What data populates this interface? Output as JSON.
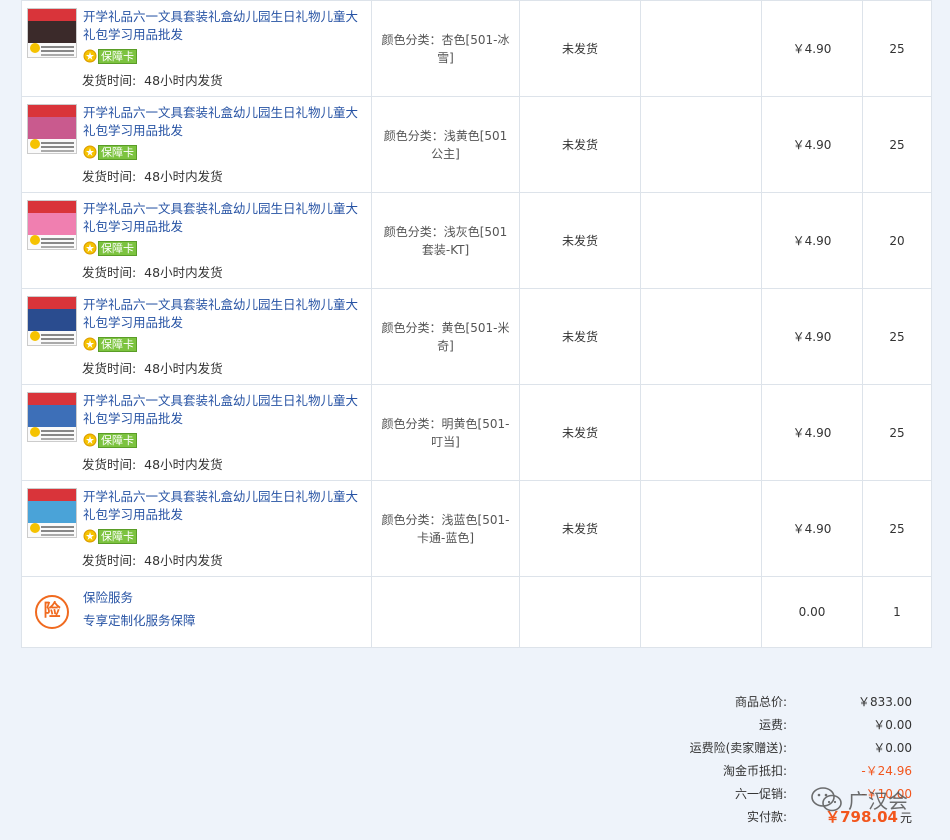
{
  "items": [
    {
      "title": "开学礼品六一文具套装礼盒幼儿园生日礼物儿童大礼包学习用品批发",
      "badge": "保障卡",
      "ship_label": "发货时间:",
      "ship_value": "48小时内发货",
      "sku": "颜色分类：杏色[501-冰雪]",
      "status": "未发货",
      "price": "￥4.90",
      "qty": "25",
      "thumb_colors": [
        "#d9343a",
        "#3b2a2a"
      ]
    },
    {
      "title": "开学礼品六一文具套装礼盒幼儿园生日礼物儿童大礼包学习用品批发",
      "badge": "保障卡",
      "ship_label": "发货时间:",
      "ship_value": "48小时内发货",
      "sku": "颜色分类：浅黄色[501公主]",
      "status": "未发货",
      "price": "￥4.90",
      "qty": "25",
      "thumb_colors": [
        "#d9343a",
        "#c95a8e"
      ]
    },
    {
      "title": "开学礼品六一文具套装礼盒幼儿园生日礼物儿童大礼包学习用品批发",
      "badge": "保障卡",
      "ship_label": "发货时间:",
      "ship_value": "48小时内发货",
      "sku": "颜色分类：浅灰色[501套装-KT]",
      "status": "未发货",
      "price": "￥4.90",
      "qty": "20",
      "thumb_colors": [
        "#d9343a",
        "#f07fb0"
      ]
    },
    {
      "title": "开学礼品六一文具套装礼盒幼儿园生日礼物儿童大礼包学习用品批发",
      "badge": "保障卡",
      "ship_label": "发货时间:",
      "ship_value": "48小时内发货",
      "sku": "颜色分类：黄色[501-米奇]",
      "status": "未发货",
      "price": "￥4.90",
      "qty": "25",
      "thumb_colors": [
        "#d9343a",
        "#2a4c8f"
      ]
    },
    {
      "title": "开学礼品六一文具套装礼盒幼儿园生日礼物儿童大礼包学习用品批发",
      "badge": "保障卡",
      "ship_label": "发货时间:",
      "ship_value": "48小时内发货",
      "sku": "颜色分类：明黄色[501-叮当]",
      "status": "未发货",
      "price": "￥4.90",
      "qty": "25",
      "thumb_colors": [
        "#d9343a",
        "#3d6fb8"
      ]
    },
    {
      "title": "开学礼品六一文具套装礼盒幼儿园生日礼物儿童大礼包学习用品批发",
      "badge": "保障卡",
      "ship_label": "发货时间:",
      "ship_value": "48小时内发货",
      "sku": "颜色分类：浅蓝色[501-卡通-蓝色]",
      "status": "未发货",
      "price": "￥4.90",
      "qty": "25",
      "thumb_colors": [
        "#d9343a",
        "#4aa3d8"
      ]
    }
  ],
  "service": {
    "icon_char": "险",
    "title": "保险服务",
    "subtitle": "专享定制化服务保障",
    "price": "0.00",
    "qty": "1"
  },
  "summary": {
    "rows": [
      {
        "label": "商品总价:",
        "value": "￥833.00"
      },
      {
        "label": "运费:",
        "value": "￥0.00"
      },
      {
        "label": "运费险(卖家赠送):",
        "value": "￥0.00"
      },
      {
        "label": "淘金币抵扣:",
        "value": "-￥24.96"
      },
      {
        "label": "六一促销:",
        "value": "-￥10.00"
      }
    ],
    "final_label": "实付款:",
    "final_value": "￥798.04",
    "final_unit": "元"
  },
  "watermark": {
    "text": "广汉会"
  },
  "colors": {
    "link": "#2753a4",
    "accent_red": "#f2561d",
    "border": "#dde3ea",
    "background": "#eef3fa"
  }
}
